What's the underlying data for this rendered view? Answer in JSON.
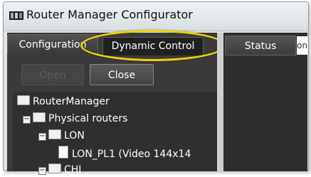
{
  "window": {
    "title": "Router Manager Configurator"
  },
  "tabs": {
    "configuration": "Configuration",
    "dynamic_control": "Dynamic Control"
  },
  "buttons": {
    "open": "Open",
    "close": "Close"
  },
  "tree": {
    "root": "RouterManager",
    "physical_routers": "Physical routers",
    "lon": "LON",
    "lon_pl1": "LON_PL1 (Video 144x14",
    "chi": "CHI"
  },
  "status_table": {
    "header": "Status",
    "first_cell": "ons"
  },
  "colors": {
    "highlight": "#ead10d",
    "panel_bg": "#3a3a3a"
  }
}
